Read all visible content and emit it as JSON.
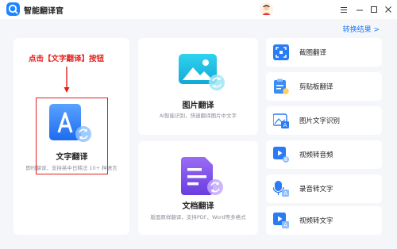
{
  "app": {
    "title": "智能翻译官",
    "username": ""
  },
  "header": {
    "convert_result": "转换结果 >"
  },
  "annotation": {
    "text": "点击【文字翻译】按钮"
  },
  "cards": {
    "text_translate": {
      "title": "文字翻译",
      "desc": "即时翻译，支持英中日韩法 10+ 种语言",
      "icon": "text-translate-icon"
    },
    "image_translate": {
      "title": "图片翻译",
      "desc": "AI智能识别，快速翻译图片中文字",
      "icon": "image-translate-icon"
    },
    "doc_translate": {
      "title": "文档翻译",
      "desc": "版面原样翻译，支持PDF、Word等多格式",
      "icon": "document-translate-icon"
    }
  },
  "side_items": [
    {
      "label": "截图翻译",
      "icon": "screenshot-icon"
    },
    {
      "label": "剪贴板翻译",
      "icon": "clipboard-icon"
    },
    {
      "label": "图片文字识别",
      "icon": "ocr-icon"
    },
    {
      "label": "视频转音频",
      "icon": "video-to-audio-icon"
    },
    {
      "label": "录音转文字",
      "icon": "recording-to-text-icon"
    },
    {
      "label": "视频转文字",
      "icon": "video-to-text-icon"
    }
  ],
  "colors": {
    "accent": "#1e86ff",
    "annotation_red": "#e0201b",
    "doc_purple": "#7a4ae8",
    "image_cyan": "#1fc4e0"
  }
}
